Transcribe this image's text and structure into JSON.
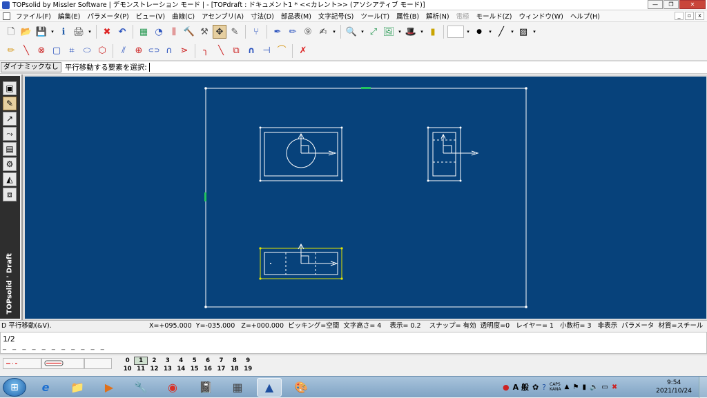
{
  "window": {
    "title": "TOPsolid by Missler Software | デモンストレーション モード | - [TOPdraft : ドキュメント1 *  <<カレント>> (アソシアティブ モード)]",
    "buttons": {
      "minimize": "—",
      "maximize": "❐",
      "close": "✕"
    }
  },
  "menu": {
    "items": [
      "ファイル(F)",
      "編集(E)",
      "パラメータ(P)",
      "ビュー(V)",
      "曲線(C)",
      "アセンブリ(A)",
      "寸法(D)",
      "部品表(M)",
      "文字記号(S)",
      "ツール(T)",
      "属性(B)",
      "解析(N)",
      "電極",
      "モールド(Z)",
      "ウィンドウ(W)",
      "ヘルプ(H)"
    ],
    "disabled_index": 12,
    "mdi": [
      "_",
      "▫",
      "x"
    ]
  },
  "toolbar1": {
    "icons": [
      "new-file-icon",
      "open-folder-icon",
      "save-icon",
      "info-icon",
      "print-icon",
      "delete-icon",
      "undo-icon",
      "layers-icon",
      "view-icon",
      "parameters-icon",
      "hammer-icon",
      "tools-icon",
      "move-icon",
      "edit-icon",
      "tree-icon",
      "pen-icon",
      "pencil-icon",
      "hook-icon",
      "signature-icon",
      "zoom-icon",
      "fit-icon",
      "image-icon",
      "hat-icon",
      "cylinder-icon"
    ],
    "glyphs": [
      "🗋",
      "📂",
      "💾",
      "ℹ",
      "🖨",
      "✖",
      "↶",
      "▦",
      "◔",
      "⫼",
      "🔨",
      "⚒",
      "✥",
      "✎",
      "⑂",
      "✒",
      "✏",
      "⑨",
      "✍",
      "🔍",
      "⤢",
      "🖼",
      "🎩",
      "▮"
    ]
  },
  "toolbar2": {
    "icons": [
      "draw-icon",
      "line-icon",
      "circle-icon",
      "rectangle-icon",
      "frame-icon",
      "ellipse-icon",
      "polygon-icon",
      "parallel-icon",
      "point-icon",
      "slot-icon",
      "arc-icon",
      "chamfer-icon",
      "corner-icon",
      "fillet-icon",
      "box-icon",
      "arch-icon",
      "trim-icon",
      "curve-icon",
      "cancel-icon"
    ],
    "glyphs": [
      "✏",
      "╲",
      "⊗",
      "▢",
      "⌗",
      "⬭",
      "⬡",
      "⫽",
      "⊕",
      "⊂⊃",
      "∩",
      "⋗",
      "╮",
      "╲",
      "⧉",
      "∩",
      "⊣",
      "⌒",
      "✗"
    ]
  },
  "command": {
    "dynamic_button": "ダイナミックなし",
    "prompt": "平行移動する要素を選択:"
  },
  "left_toolbar": {
    "icons": [
      "select-icon",
      "pencil-icon",
      "line-tool-icon",
      "measure-icon",
      "table-icon",
      "gear-icon",
      "paint-icon",
      "cube-icon"
    ],
    "glyphs": [
      "▣",
      "✎",
      "↗",
      "⤳",
      "▤",
      "⚙",
      "◭",
      "⧈"
    ],
    "brand": "TOPsolid ' Draft"
  },
  "status": {
    "command": "D 平行移動(&V).",
    "x": "X=+095.000",
    "y": "Y=-035.000",
    "z": "Z=+000.000",
    "picking": "ピッキング=空間",
    "text_height": "文字高さ=  4",
    "display": "表示=   0.2",
    "snap": "スナップ= 有効",
    "transparency": "透明度=0",
    "layer": "レイヤー=  1",
    "decimals": "小数桁= 3",
    "hide": "非表示",
    "params": "パラメータ",
    "material": "材質=スチール"
  },
  "message": {
    "line1": "1/2",
    "line2": "_ _ _ _ _ _ _ _ _ _ _"
  },
  "layers": {
    "row1": [
      "0",
      "1",
      "2",
      "3",
      "4",
      "5",
      "6",
      "7",
      "8",
      "9"
    ],
    "row2": [
      "10",
      "11",
      "12",
      "13",
      "14",
      "15",
      "16",
      "17",
      "18",
      "19"
    ],
    "current": "1"
  },
  "taskbar": {
    "start": "⊞",
    "apps": [
      "ie-icon",
      "explorer-icon",
      "media-icon",
      "tools-icon",
      "chrome-icon",
      "notepad-icon",
      "calculator-icon",
      "topsolid-icon",
      "paint-icon"
    ],
    "glyphs": [
      "e",
      "📁",
      "▶",
      "🔧",
      "◉",
      "📓",
      "▦",
      "▲",
      "🎨"
    ],
    "active_index": 7,
    "ime": "A 般",
    "caps": "CAPS",
    "kana": "KANA",
    "time": "9:54",
    "date": "2021/10/24"
  },
  "colors": {
    "canvas_bg": "#07427b",
    "drawing_line": "#ffffff",
    "selection": "#e6e600",
    "marker": "#22c55e"
  }
}
